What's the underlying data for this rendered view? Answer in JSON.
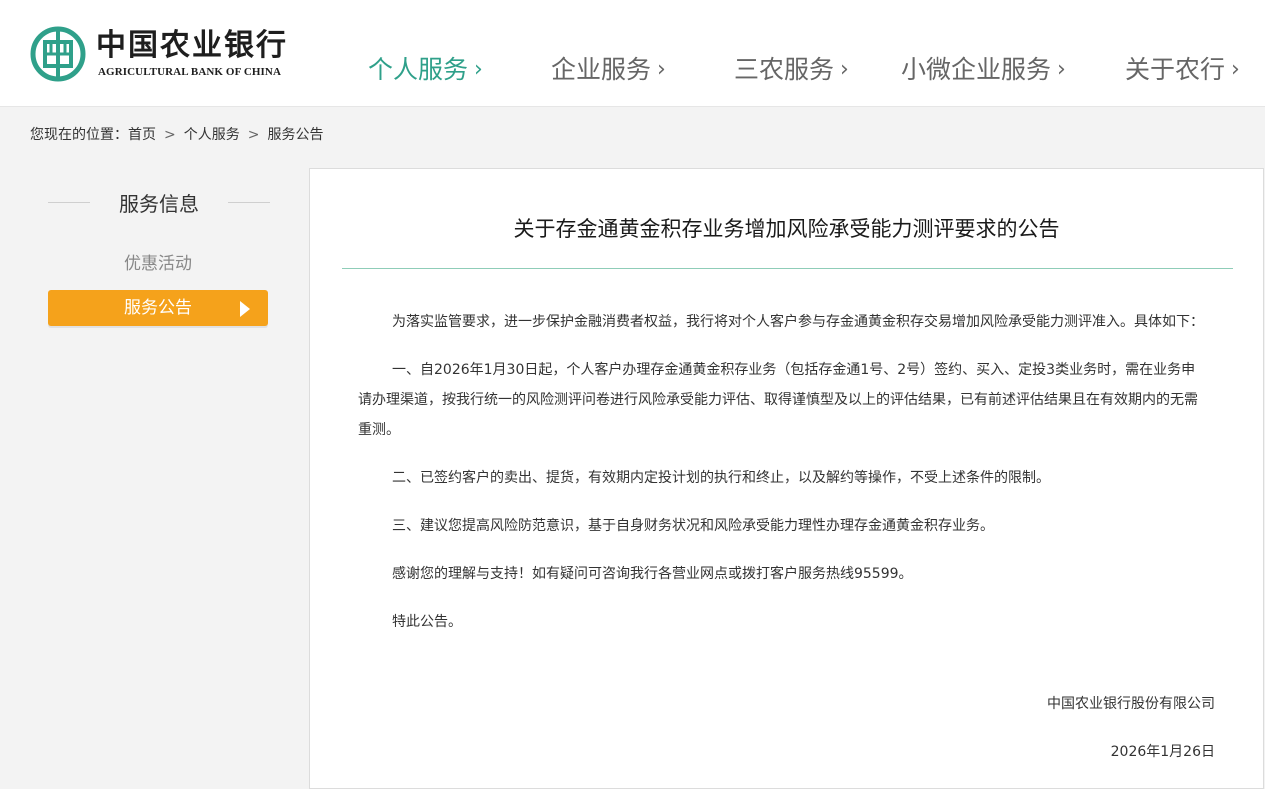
{
  "header": {
    "logo_cn": "中国农业银行",
    "logo_en": "AGRICULTURAL BANK OF CHINA",
    "brand_color": "#2fa08a",
    "nav": [
      {
        "label": "个人服务",
        "active": true
      },
      {
        "label": "企业服务",
        "active": false
      },
      {
        "label": "三农服务",
        "active": false
      },
      {
        "label": "小微企业服务",
        "active": false
      },
      {
        "label": "关于农行",
        "active": false
      }
    ],
    "nav_chevron": "›"
  },
  "breadcrumb": {
    "prefix": "您现在的位置：",
    "items": [
      "首页",
      "个人服务",
      "服务公告"
    ],
    "separator": ">"
  },
  "sidebar": {
    "title": "服务信息",
    "items": [
      {
        "label": "优惠活动",
        "active": false
      },
      {
        "label": "服务公告",
        "active": true
      }
    ],
    "active_color": "#f5a21b"
  },
  "article": {
    "title": "关于存金通黄金积存业务增加风险承受能力测评要求的公告",
    "paragraphs": [
      "为落实监管要求，进一步保护金融消费者权益，我行将对个人客户参与存金通黄金积存交易增加风险承受能力测评准入。具体如下：",
      "一、自2026年1月30日起，个人客户办理存金通黄金积存业务（包括存金通1号、2号）签约、买入、定投3类业务时，需在业务申请办理渠道，按我行统一的风险测评问卷进行风险承受能力评估、取得谨慎型及以上的评估结果，已有前述评估结果且在有效期内的无需重测。",
      "二、已签约客户的卖出、提货，有效期内定投计划的执行和终止，以及解约等操作，不受上述条件的限制。",
      "三、建议您提高风险防范意识，基于自身财务状况和风险承受能力理性办理存金通黄金积存业务。",
      "感谢您的理解与支持！如有疑问可咨询我行各营业网点或拨打客户服务热线95599。",
      "特此公告。"
    ],
    "signature": "中国农业银行股份有限公司",
    "date": "2026年1月26日"
  }
}
